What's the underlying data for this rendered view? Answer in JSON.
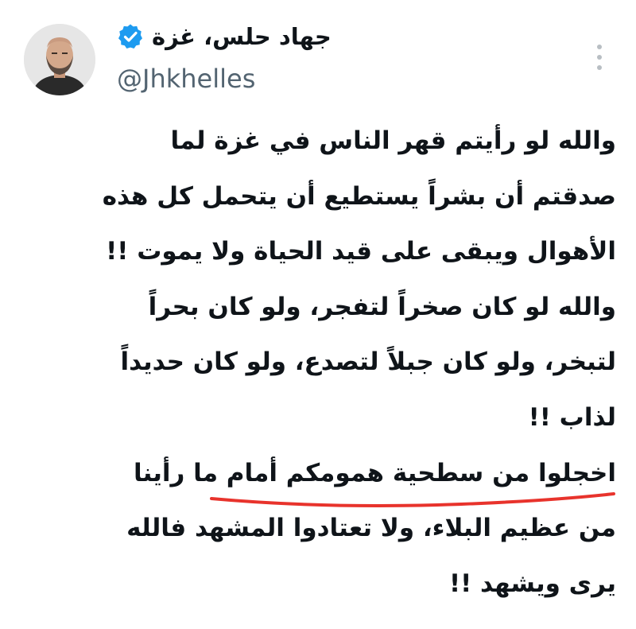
{
  "tweet": {
    "display_name": "جهاد حلس، غزة",
    "handle": "@Jhkhelles",
    "lines": [
      "والله لو رأيتم قهر الناس في غزة لما",
      "صدقتم أن بشراً يستطيع أن يتحمل كل هذه",
      "الأهوال ويبقى على قيد الحياة ولا يموت !!",
      "والله لو كان صخراً لتفجر، ولو كان بحراً",
      "لتبخر، ولو كان جبلاً لتصدع، ولو كان حديداً",
      "لذاب !!",
      "اخجلوا من سطحية همومكم أمام ما رأينا",
      "من عظيم البلاء، ولا تعتادوا المشهد فالله",
      "يرى ويشهد !!"
    ]
  },
  "icons": {
    "verified": "verified-badge-icon",
    "more": "more-options-icon"
  },
  "colors": {
    "text": "#0f1419",
    "secondary_text": "#536471",
    "verified_blue": "#1d9bf0",
    "underline_red": "#e8332c"
  }
}
